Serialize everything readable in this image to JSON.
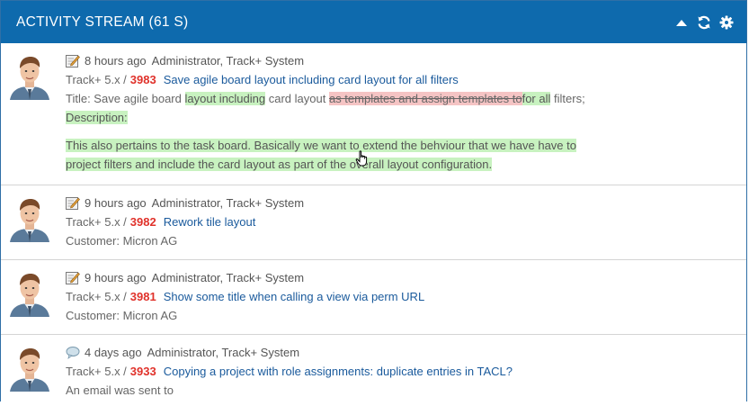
{
  "header": {
    "title": "ACTIVITY STREAM (61 S)"
  },
  "entries": [
    {
      "time": "8 hours ago",
      "author": "Administrator, Track+ System",
      "project": "Track+ 5.x /",
      "issue_no": "3983",
      "issue_title": "Save agile board layout including card layout for all filters",
      "change_title_label": "Title: Save agile board",
      "change_added1": "layout including",
      "change_plain1": "card layout",
      "change_deleted": "as templates and assign templates to",
      "change_added2": "for all",
      "change_plain2": "filters;",
      "description_label": "Description:",
      "description_line1": "This also pertains to the task board. Basically we want to extend the behviour that we have have to",
      "description_line2": "project filters and include the card layout as part of the overall layout configuration."
    },
    {
      "time": "9 hours ago",
      "author": "Administrator, Track+ System",
      "project": "Track+ 5.x /",
      "issue_no": "3982",
      "issue_title": "Rework tile layout",
      "detail": "Customer: Micron AG"
    },
    {
      "time": "9 hours ago",
      "author": "Administrator, Track+ System",
      "project": "Track+ 5.x /",
      "issue_no": "3981",
      "issue_title": "Show some title when calling a view via perm URL",
      "detail": "Customer: Micron AG"
    },
    {
      "time": "4 days ago",
      "author": "Administrator, Track+ System",
      "project": "Track+ 5.x /",
      "issue_no": "3933",
      "issue_title": "Copying a project with role assignments: duplicate entries in TACL?",
      "detail": "An email was sent to"
    }
  ]
}
